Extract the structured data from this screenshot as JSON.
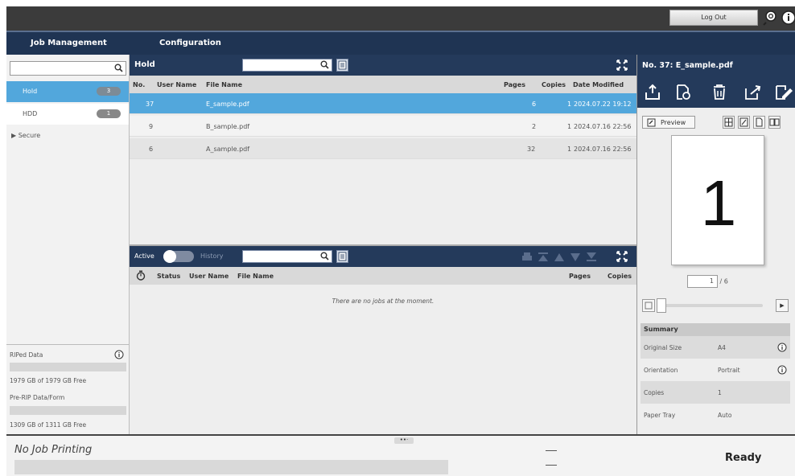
{
  "topbar": {
    "logout_label": "Log Out"
  },
  "menu": {
    "items": [
      "Job Management",
      "Configuration"
    ]
  },
  "sidebar": {
    "folders": [
      {
        "label": "Hold",
        "count": "3"
      },
      {
        "label": "HDD",
        "count": "1"
      },
      {
        "label": "Secure"
      }
    ],
    "storage": [
      {
        "label": "RIPed Data",
        "free": "1979 GB of 1979 GB Free"
      },
      {
        "label": "Pre-RIP Data/Form",
        "free": "1309 GB of 1311 GB Free"
      }
    ]
  },
  "hold": {
    "title": "Hold",
    "columns": {
      "no": "No.",
      "user": "User Name",
      "file": "File Name",
      "pages": "Pages",
      "copies": "Copies",
      "date": "Date Modified"
    },
    "rows": [
      {
        "no": "37",
        "file": "E_sample.pdf",
        "pages": "6",
        "copies": "1",
        "date": "2024.07.22 19:12"
      },
      {
        "no": "9",
        "file": "B_sample.pdf",
        "pages": "2",
        "copies": "1",
        "date": "2024.07.16 22:56"
      },
      {
        "no": "6",
        "file": "A_sample.pdf",
        "pages": "32",
        "copies": "1",
        "date": "2024.07.16 22:56"
      }
    ]
  },
  "active": {
    "toggle_on": "Active",
    "toggle_off": "History",
    "columns": {
      "status": "Status",
      "user": "User Name",
      "file": "File Name",
      "pages": "Pages",
      "copies": "Copies"
    },
    "empty_message": "There are no jobs at the moment."
  },
  "detail": {
    "title": "No. 37: E_sample.pdf",
    "preview_label": "Preview",
    "page_big": "1",
    "page_current": "1",
    "page_total": "/ 6",
    "summary_label": "Summary",
    "summary": [
      {
        "key": "Original Size",
        "value": "A4"
      },
      {
        "key": "Orientation",
        "value": "Portrait"
      },
      {
        "key": "Copies",
        "value": "1"
      },
      {
        "key": "Paper Tray",
        "value": "Auto"
      }
    ]
  },
  "status": {
    "printing": "No Job Printing",
    "state": "Ready"
  }
}
